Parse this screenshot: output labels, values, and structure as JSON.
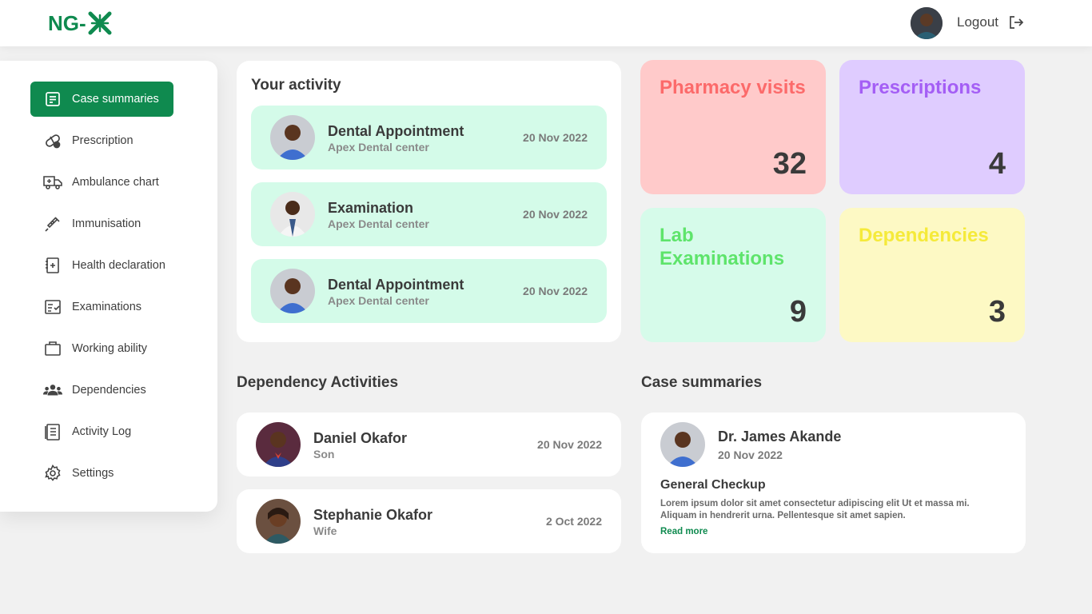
{
  "header": {
    "logo_text": "NG-",
    "logout_label": "Logout"
  },
  "sidebar": {
    "items": [
      {
        "label": "Case summaries",
        "icon": "note-icon",
        "active": true
      },
      {
        "label": "Prescription",
        "icon": "pill-icon"
      },
      {
        "label": "Ambulance chart",
        "icon": "ambulance-icon"
      },
      {
        "label": "Immunisation",
        "icon": "syringe-icon"
      },
      {
        "label": "Health declaration",
        "icon": "declaration-icon"
      },
      {
        "label": "Examinations",
        "icon": "checklist-icon"
      },
      {
        "label": "Working ability",
        "icon": "briefcase-icon"
      },
      {
        "label": "Dependencies",
        "icon": "people-icon"
      },
      {
        "label": "Activity Log",
        "icon": "log-icon"
      },
      {
        "label": "Settings",
        "icon": "gear-icon"
      }
    ]
  },
  "activity": {
    "title": "Your activity",
    "items": [
      {
        "title": "Dental Appointment",
        "place": "Apex Dental center",
        "date": "20 Nov 2022"
      },
      {
        "title": "Examination",
        "place": "Apex Dental center",
        "date": "20 Nov 2022"
      },
      {
        "title": "Dental Appointment",
        "place": "Apex Dental center",
        "date": "20 Nov 2022"
      }
    ]
  },
  "stats": [
    {
      "label": "Pharmacy visits",
      "value": "32",
      "bg": "#ffcaca",
      "fg": "#fc6a6a"
    },
    {
      "label": "Prescriptions",
      "value": "4",
      "bg": "#dfccff",
      "fg": "#a45ef5"
    },
    {
      "label": "Lab Examinations",
      "value": "9",
      "bg": "#d6fbea",
      "fg": "#5ee46b"
    },
    {
      "label": "Dependencies",
      "value": "3",
      "bg": "#fdf9c4",
      "fg": "#f5ea3a"
    }
  ],
  "dependency": {
    "title": "Dependency Activities",
    "items": [
      {
        "name": "Daniel Okafor",
        "relation": "Son",
        "date": "20 Nov 2022"
      },
      {
        "name": "Stephanie Okafor",
        "relation": "Wife",
        "date": "2 Oct 2022"
      }
    ]
  },
  "case_summaries": {
    "title": "Case summaries",
    "doctor": "Dr. James Akande",
    "date": "20 Nov 2022",
    "case_title": "General Checkup",
    "body": "Lorem ipsum dolor sit amet consectetur adipiscing elit Ut et massa mi. Aliquam in hendrerit urna. Pellentesque sit amet sapien.",
    "read_more": "Read more"
  },
  "colors": {
    "brand": "#0f8a4f",
    "activity_bg": "#d4fbe9"
  }
}
